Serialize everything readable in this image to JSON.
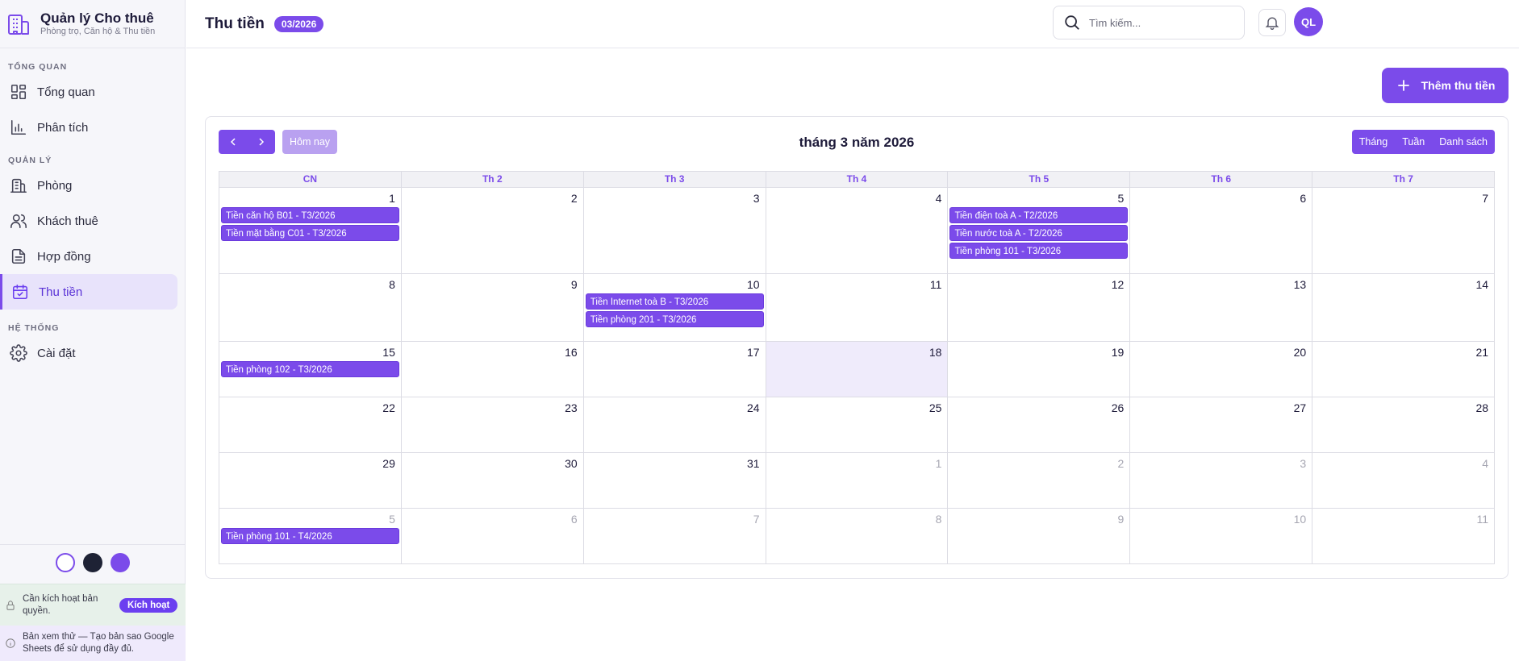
{
  "brand": {
    "title": "Quản lý Cho thuê",
    "subtitle": "Phòng trọ, Căn hộ & Thu tiền"
  },
  "sidebar": {
    "sections": [
      {
        "label": "TỔNG QUAN",
        "items": [
          {
            "label": "Tổng quan",
            "icon": "dashboard-icon"
          },
          {
            "label": "Phân tích",
            "icon": "bar-chart-icon"
          }
        ]
      },
      {
        "label": "QUẢN LÝ",
        "items": [
          {
            "label": "Phòng",
            "icon": "building-icon"
          },
          {
            "label": "Khách thuê",
            "icon": "users-icon"
          },
          {
            "label": "Hợp đồng",
            "icon": "document-icon"
          },
          {
            "label": "Thu tiền",
            "icon": "calendar-check-icon",
            "active": true
          }
        ]
      },
      {
        "label": "HỆ THỐNG",
        "items": [
          {
            "label": "Cài đặt",
            "icon": "gear-icon"
          }
        ]
      }
    ],
    "themes": [
      "#ffffff",
      "#1e2235",
      "#7b4bea"
    ],
    "license": {
      "text": "Cần kích hoạt bản quyền.",
      "button": "Kích hoạt"
    },
    "preview": {
      "text": "Bản xem thử — Tạo bản sao Google Sheets để sử dụng đầy đủ."
    }
  },
  "header": {
    "title": "Thu tiền",
    "badge": "03/2026",
    "search_placeholder": "Tìm kiếm...",
    "avatar": "QL"
  },
  "main": {
    "add_button": "Thêm thu tiền"
  },
  "calendar": {
    "title": "tháng 3 năm 2026",
    "today_label": "Hôm nay",
    "views": [
      "Tháng",
      "Tuần",
      "Danh sách"
    ],
    "weekdays": [
      "CN",
      "Th 2",
      "Th 3",
      "Th 4",
      "Th 5",
      "Th 6",
      "Th 7"
    ],
    "weeks": [
      {
        "days": [
          {
            "n": "1",
            "events": [
              "Tiền căn hộ B01 - T3/2026",
              "Tiền mặt bằng C01 - T3/2026"
            ]
          },
          {
            "n": "2"
          },
          {
            "n": "3"
          },
          {
            "n": "4"
          },
          {
            "n": "5",
            "events": [
              "Tiền điện toà A - T2/2026",
              "Tiền nước toà A - T2/2026",
              "Tiền phòng 101 - T3/2026"
            ]
          },
          {
            "n": "6"
          },
          {
            "n": "7"
          }
        ]
      },
      {
        "days": [
          {
            "n": "8"
          },
          {
            "n": "9"
          },
          {
            "n": "10",
            "events": [
              "Tiền Internet toà B - T3/2026",
              "Tiền phòng 201 - T3/2026"
            ]
          },
          {
            "n": "11"
          },
          {
            "n": "12"
          },
          {
            "n": "13"
          },
          {
            "n": "14"
          }
        ]
      },
      {
        "days": [
          {
            "n": "15",
            "events": [
              "Tiền phòng 102 - T3/2026"
            ]
          },
          {
            "n": "16"
          },
          {
            "n": "17"
          },
          {
            "n": "18",
            "today": true
          },
          {
            "n": "19"
          },
          {
            "n": "20"
          },
          {
            "n": "21"
          }
        ]
      },
      {
        "days": [
          {
            "n": "22"
          },
          {
            "n": "23"
          },
          {
            "n": "24"
          },
          {
            "n": "25"
          },
          {
            "n": "26"
          },
          {
            "n": "27"
          },
          {
            "n": "28"
          }
        ]
      },
      {
        "days": [
          {
            "n": "29"
          },
          {
            "n": "30"
          },
          {
            "n": "31"
          },
          {
            "n": "1",
            "other": true
          },
          {
            "n": "2",
            "other": true
          },
          {
            "n": "3",
            "other": true
          },
          {
            "n": "4",
            "other": true
          }
        ]
      },
      {
        "days": [
          {
            "n": "5",
            "other": true,
            "events": [
              "Tiền phòng 101 - T4/2026"
            ]
          },
          {
            "n": "6",
            "other": true
          },
          {
            "n": "7",
            "other": true
          },
          {
            "n": "8",
            "other": true
          },
          {
            "n": "9",
            "other": true
          },
          {
            "n": "10",
            "other": true
          },
          {
            "n": "11",
            "other": true
          }
        ]
      }
    ]
  }
}
